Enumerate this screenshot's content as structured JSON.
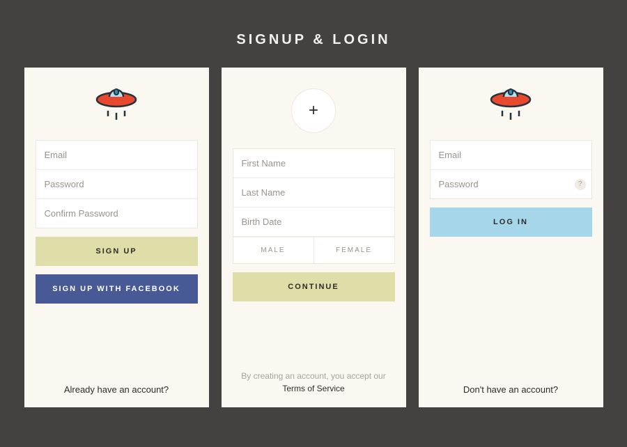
{
  "title": "SIGNUP & LOGIN",
  "signup": {
    "email_ph": "Email",
    "password_ph": "Password",
    "confirm_ph": "Confirm Password",
    "signup_btn": "SIGN UP",
    "facebook_btn": "SIGN UP WITH FACEBOOK",
    "footer": "Already have an account?"
  },
  "profile": {
    "first_ph": "First Name",
    "last_ph": "Last Name",
    "birth_ph": "Birth Date",
    "male": "MALE",
    "female": "FEMALE",
    "continue_btn": "CONTINUE",
    "tos_line": "By creating an account, you accept our",
    "tos_link": "Terms of Service"
  },
  "login": {
    "email_ph": "Email",
    "password_ph": "Password",
    "help": "?",
    "login_btn": "LOG IN",
    "footer": "Don't have an account?"
  }
}
